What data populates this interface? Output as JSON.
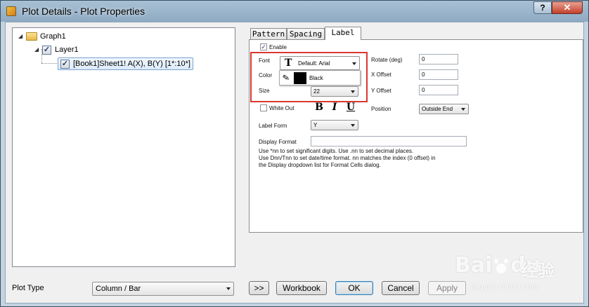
{
  "window": {
    "title": "Plot Details - Plot Properties",
    "help": "?",
    "close": "✕"
  },
  "tree": {
    "graph": "Graph1",
    "layer": "Layer1",
    "plot": "[Book1]Sheet1! A(X), B(Y) [1*:10*]"
  },
  "tabs": [
    {
      "label": "Pattern"
    },
    {
      "label": "Spacing"
    },
    {
      "label": "Label"
    }
  ],
  "label_panel": {
    "enable": "Enable",
    "font_label": "Font",
    "font_value": "Default: Arial",
    "font_glyph": "T",
    "color_label": "Color",
    "color_value": "Black",
    "size_label": "Size",
    "size_value": "22",
    "white_out": "White Out",
    "bold": "B",
    "italic": "I",
    "underline": "U",
    "label_form_label": "Label Form",
    "label_form_value": "Y",
    "display_format_label": "Display Format",
    "display_format_value": "",
    "rotate_label": "Rotate (deg)",
    "rotate_value": "0",
    "x_offset_label": "X Offset",
    "x_offset_value": "0",
    "y_offset_label": "Y Offset",
    "y_offset_value": "0",
    "position_label": "Position",
    "position_value": "Outside End",
    "help_line1": "Use *nn to set significant digits. Use .nn to set decimal places.",
    "help_line2": "Use Dnn/Tnn to set date/time format. nn matches the index (0 offset) in",
    "help_line3": "the Display dropdown list for Format Cells dialog."
  },
  "footer": {
    "plot_type_label": "Plot Type",
    "plot_type_value": "Column / Bar",
    "expand": ">>",
    "workbook": "Workbook",
    "ok": "OK",
    "cancel": "Cancel",
    "apply": "Apply"
  },
  "watermark": {
    "brand": "Bai",
    "brand2": "du",
    "cn": "经验",
    "url": "jingyan.baidu.com"
  },
  "colors": {
    "highlight_box": "#d9382f",
    "black_swatch": "#000000"
  }
}
